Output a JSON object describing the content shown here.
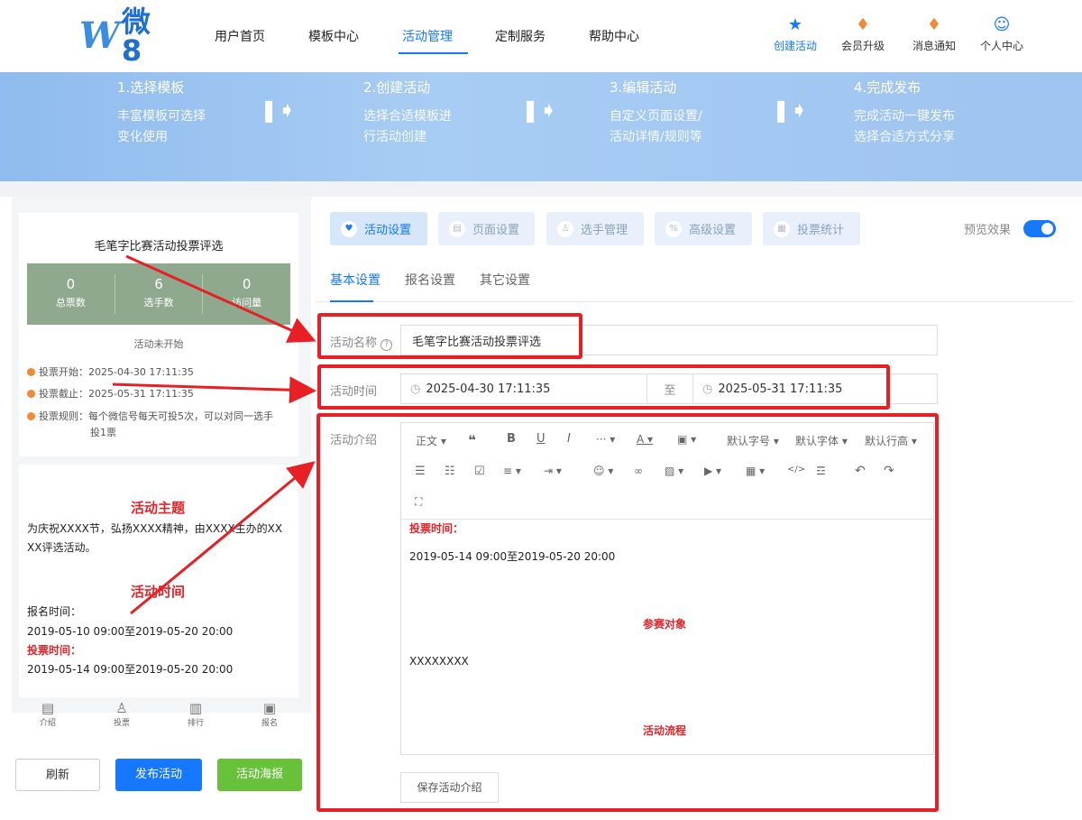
{
  "header": {
    "logo_w": "W",
    "logo_text": "微8",
    "nav": [
      "用户首页",
      "模板中心",
      "活动管理",
      "定制服务",
      "帮助中心"
    ],
    "active_nav": "活动管理",
    "icons": [
      {
        "label": "创建活动",
        "icon": "star-icon",
        "color": "#1677ff"
      },
      {
        "label": "会员升级",
        "icon": "crown-icon",
        "color": "#f08a36"
      },
      {
        "label": "消息通知",
        "icon": "bell-icon",
        "color": "#f08a36"
      },
      {
        "label": "个人中心",
        "icon": "user-icon",
        "color": "#1677ff"
      }
    ]
  },
  "steps": [
    {
      "title": "1.选择模板",
      "desc1": "丰富模板可选择",
      "desc2": "变化使用"
    },
    {
      "title": "2.创建活动",
      "desc1": "选择合适模板进",
      "desc2": "行活动创建"
    },
    {
      "title": "3.编辑活动",
      "desc1": "自定义页面设置/",
      "desc2": "活动详情/规则等"
    },
    {
      "title": "4.完成发布",
      "desc1": "完成活动一键发布",
      "desc2": "选择合适方式分享"
    }
  ],
  "preview": {
    "title": "毛笔字比赛活动投票评选",
    "stats": [
      {
        "value": "0",
        "label": "总票数"
      },
      {
        "value": "6",
        "label": "选手数"
      },
      {
        "value": "0",
        "label": "访问量"
      }
    ],
    "status": "活动未开始",
    "vote_start": "投票开始：2025-04-30 17:11:35",
    "vote_end": "投票截止：2025-05-31 17:11:35",
    "vote_rule_1": "投票规则：每个微信号每天可投5次，可以对同一选手",
    "vote_rule_2": "投1票",
    "theme_heading": "活动主题",
    "theme_text_1": "为庆祝XXXX节，弘扬XXXX精神，由XXXX主办的XX",
    "theme_text_2": "XX评选活动。",
    "time_heading": "活动时间",
    "signup_label": "报名时间：",
    "signup_time": "2019-05-10 09:00至2019-05-20 20:00",
    "vote_label": "投票时间：",
    "vote_time": "2019-05-14 09:00至2019-05-20 20:00",
    "bottom_nav": [
      "介绍",
      "投票",
      "排行",
      "报名"
    ],
    "buttons": {
      "refresh": "刷新",
      "publish": "发布活动",
      "poster": "活动海报"
    }
  },
  "tabs": [
    "活动设置",
    "页面设置",
    "选手管理",
    "高级设置",
    "投票统计"
  ],
  "preview_toggle_label": "预览效果",
  "subtabs": [
    "基本设置",
    "报名设置",
    "其它设置"
  ],
  "form": {
    "name_label": "活动名称",
    "name_value": "毛笔字比赛活动投票评选",
    "time_label": "活动时间",
    "start_time": "2025-04-30 17:11:35",
    "to": "至",
    "end_time": "2025-05-31 17:11:35",
    "intro_label": "活动介绍"
  },
  "editor": {
    "toolbar_row1": [
      "正文 ▾",
      "❝",
      "B",
      "U",
      "I",
      "··· ▾",
      "A ▾",
      "▣ ▾",
      "默认字号 ▾",
      "默认字体 ▾",
      "默认行高 ▾"
    ],
    "vote_time_label": "投票时间：",
    "vote_time": "2019-05-14 09:00至2019-05-20 20:00",
    "participants_heading": "参赛对象",
    "participants": "XXXXXXXX",
    "process_heading": "活动流程"
  },
  "save_button": "保存活动介绍"
}
